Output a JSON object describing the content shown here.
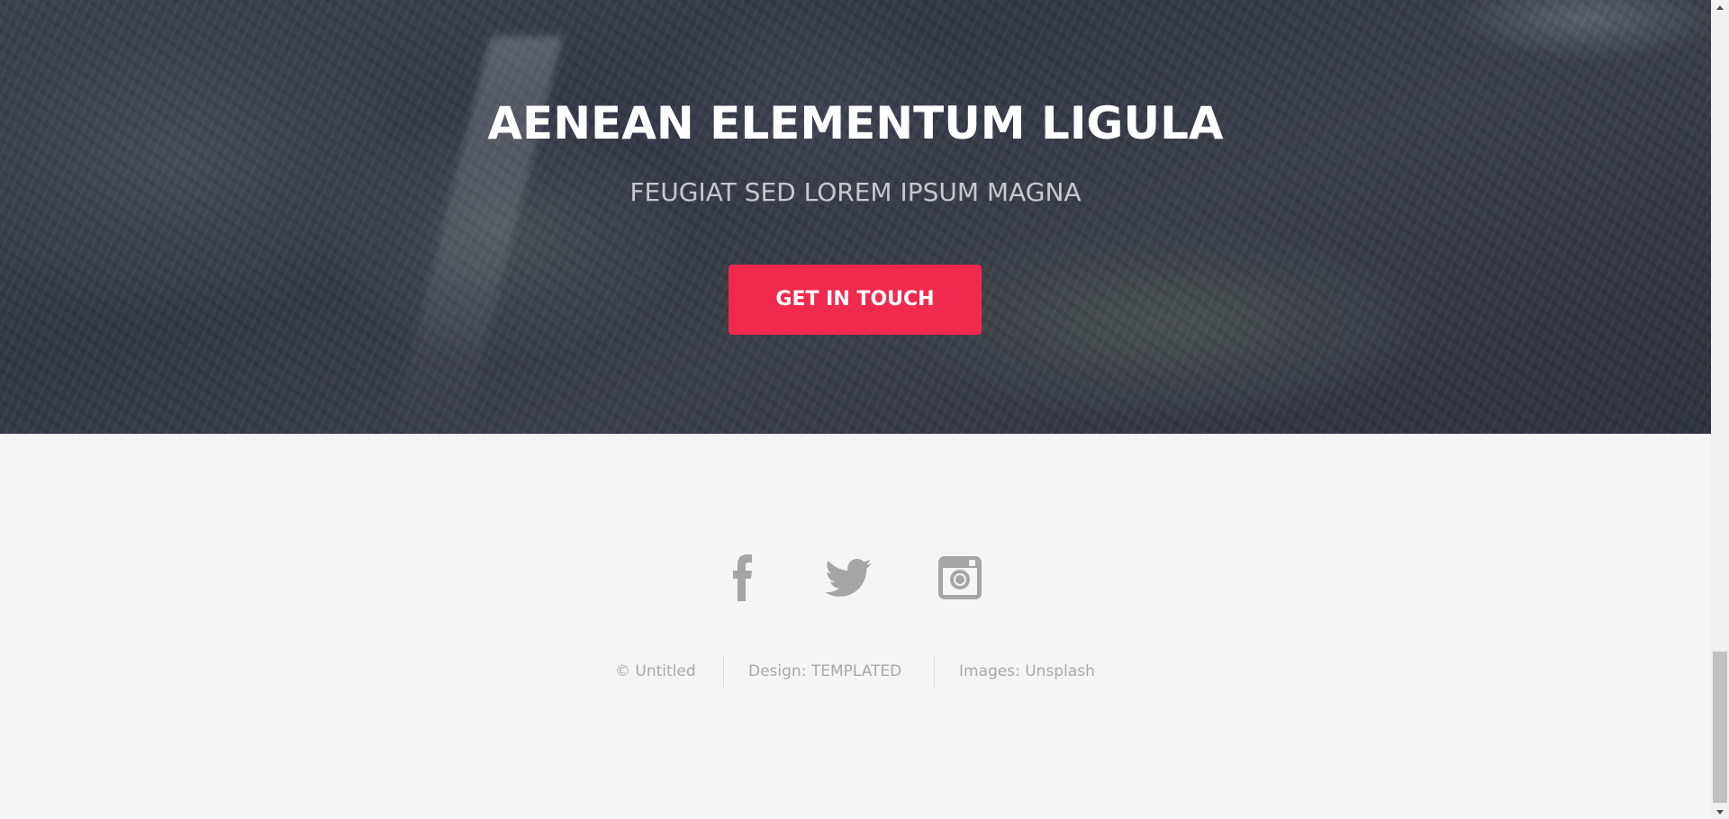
{
  "banner": {
    "title": "AENEAN ELEMENTUM LIGULA",
    "subtitle": "FEUGIAT SED LOREM IPSUM MAGNA",
    "button_label": "GET IN TOUCH",
    "button_color": "#f2294e"
  },
  "footer": {
    "social": [
      {
        "name": "facebook",
        "icon": "facebook-icon"
      },
      {
        "name": "twitter",
        "icon": "twitter-icon"
      },
      {
        "name": "instagram",
        "icon": "instagram-icon"
      }
    ],
    "copyright": {
      "owner": "© Untitled",
      "design": "Design: TEMPLATED",
      "images": "Images: Unsplash"
    },
    "icon_color": "#a5a5a5",
    "text_color": "#a8a8a8"
  }
}
